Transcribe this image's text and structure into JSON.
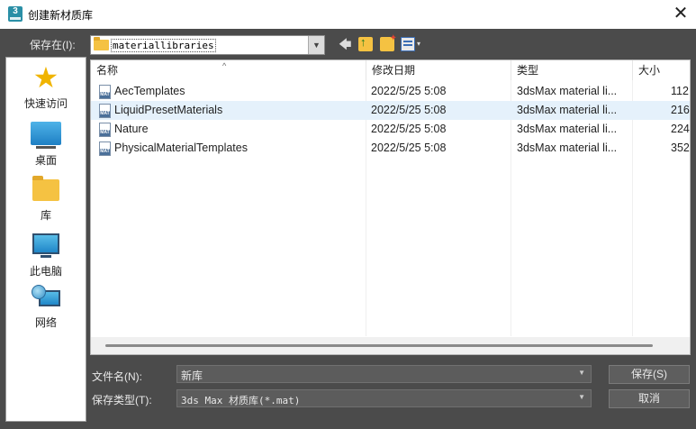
{
  "window": {
    "title": "创建新材质库",
    "app_icon_text": "3",
    "close_glyph": "✕"
  },
  "toolbar": {
    "save_in_label": "保存在(I):",
    "path_value": "materiallibraries",
    "dropdown_glyph": "▼",
    "back_glyph": "🡄",
    "view_dropdown_glyph": "▾"
  },
  "places": [
    {
      "label": "快速访问",
      "icon": "star-icon"
    },
    {
      "label": "桌面",
      "icon": "desktop-icon"
    },
    {
      "label": "库",
      "icon": "library-folder-icon"
    },
    {
      "label": "此电脑",
      "icon": "computer-icon"
    },
    {
      "label": "网络",
      "icon": "network-icon"
    }
  ],
  "columns": {
    "name": "名称",
    "modified": "修改日期",
    "type": "类型",
    "size": "大小",
    "sort_glyph": "^"
  },
  "files": [
    {
      "name": "AecTemplates",
      "modified": "2022/5/25 5:08",
      "type": "3dsMax material li...",
      "size": "112",
      "selected": false
    },
    {
      "name": "LiquidPresetMaterials",
      "modified": "2022/5/25 5:08",
      "type": "3dsMax material li...",
      "size": "216",
      "selected": true
    },
    {
      "name": "Nature",
      "modified": "2022/5/25 5:08",
      "type": "3dsMax material li...",
      "size": "224",
      "selected": false
    },
    {
      "name": "PhysicalMaterialTemplates",
      "modified": "2022/5/25 5:08",
      "type": "3dsMax material li...",
      "size": "352",
      "selected": false
    }
  ],
  "form": {
    "filename_label": "文件名(N):",
    "filename_value": "新库",
    "filetype_label": "保存类型(T):",
    "filetype_value": "3ds Max 材质库(*.mat)",
    "save_button": "保存(S)",
    "cancel_button": "取消",
    "arrow_glyph": "▼"
  },
  "colors": {
    "dialog_bg": "#4b4b4b",
    "selection": "#e5f1fb",
    "folder": "#f5c242"
  }
}
